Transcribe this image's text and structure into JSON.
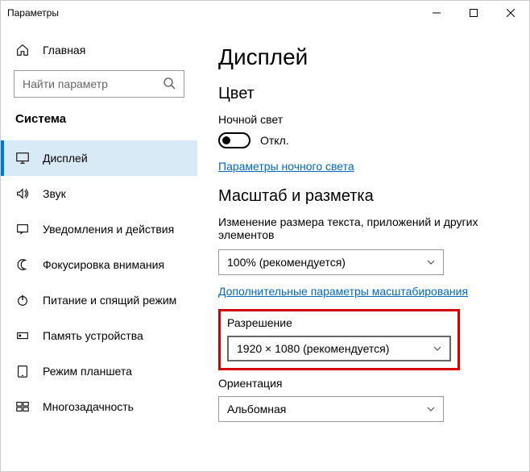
{
  "titlebar": {
    "title": "Параметры"
  },
  "sidebar": {
    "home": "Главная",
    "search_placeholder": "Найти параметр",
    "section": "Система",
    "items": [
      {
        "label": "Дисплей"
      },
      {
        "label": "Звук"
      },
      {
        "label": "Уведомления и действия"
      },
      {
        "label": "Фокусировка внимания"
      },
      {
        "label": "Питание и спящий режим"
      },
      {
        "label": "Память устройства"
      },
      {
        "label": "Режим планшета"
      },
      {
        "label": "Многозадачность"
      }
    ]
  },
  "content": {
    "page_title": "Дисплей",
    "color_header": "Цвет",
    "night_light_label": "Ночной свет",
    "toggle_state": "Откл.",
    "night_light_link": "Параметры ночного света",
    "scale_header": "Масштаб и разметка",
    "scale_desc": "Изменение размера текста, приложений и других элементов",
    "scale_value": "100% (рекомендуется)",
    "scale_link": "Дополнительные параметры масштабирования",
    "resolution_label": "Разрешение",
    "resolution_value": "1920 × 1080 (рекомендуется)",
    "orientation_label": "Ориентация",
    "orientation_value": "Альбомная"
  }
}
